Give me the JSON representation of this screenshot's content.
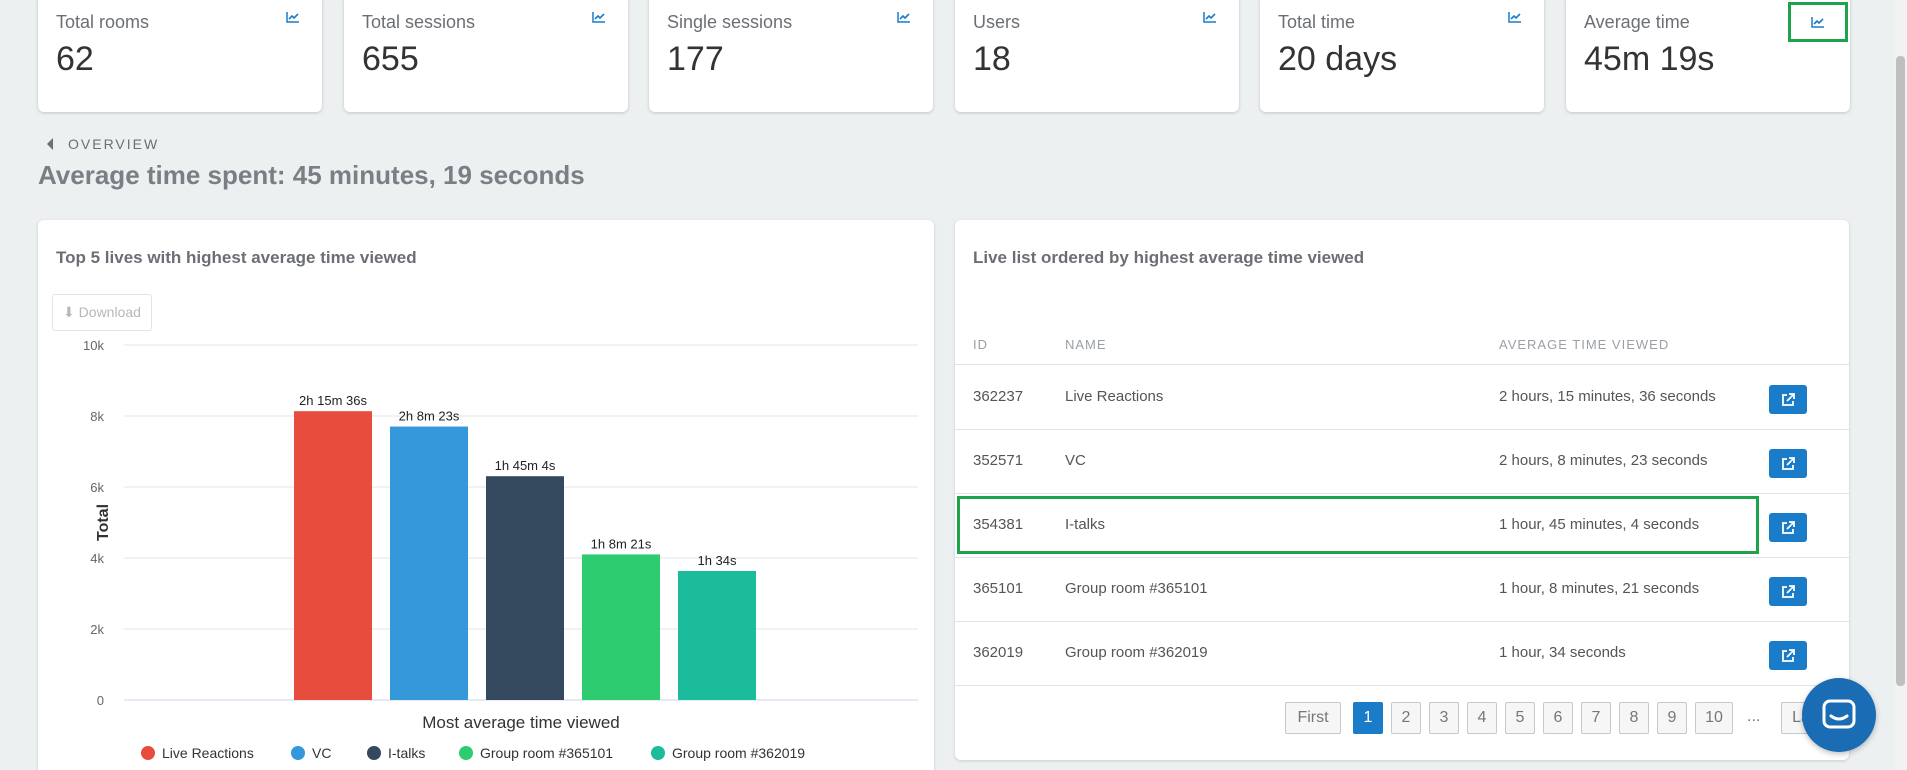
{
  "kpis": [
    {
      "title": "Total rooms",
      "value": "62"
    },
    {
      "title": "Total sessions",
      "value": "655"
    },
    {
      "title": "Single sessions",
      "value": "177"
    },
    {
      "title": "Users",
      "value": "18"
    },
    {
      "title": "Total time",
      "value": "20 days"
    },
    {
      "title": "Average time",
      "value": "45m 19s"
    }
  ],
  "overview": {
    "crumb": "OVERVIEW",
    "title": "Average time spent: 45 minutes, 19 seconds"
  },
  "left_panel": {
    "title": "Top 5 lives with highest average time viewed",
    "download_label": "⬇ Download"
  },
  "chart_data": {
    "type": "bar",
    "categories": [
      "Live Reactions",
      "VC",
      "I-talks",
      "Group room #365101",
      "Group room #362019"
    ],
    "values": [
      8136,
      7703,
      6304,
      4101,
      3634
    ],
    "data_labels": [
      "2h 15m 36s",
      "2h 8m 23s",
      "1h 45m 4s",
      "1h 8m 21s",
      "1h 34s"
    ],
    "colors": [
      "#e74c3c",
      "#3498db",
      "#34495e",
      "#2ecc71",
      "#1abc9c"
    ],
    "xlabel": "Most average time viewed",
    "ylabel": "Total",
    "ylim": [
      0,
      10000
    ],
    "yticks": [
      0,
      2000,
      4000,
      6000,
      8000,
      10000
    ],
    "ytick_labels": [
      "0",
      "2k",
      "4k",
      "6k",
      "8k",
      "10k"
    ],
    "grid": true,
    "legend_position": "bottom"
  },
  "right_panel": {
    "title": "Live list ordered by highest average time viewed",
    "columns": {
      "id": "ID",
      "name": "NAME",
      "avg": "AVERAGE TIME VIEWED"
    },
    "rows": [
      {
        "id": "362237",
        "name": "Live Reactions",
        "avg": "2 hours, 15 minutes, 36 seconds"
      },
      {
        "id": "352571",
        "name": "VC",
        "avg": "2 hours, 8 minutes, 23 seconds"
      },
      {
        "id": "354381",
        "name": "I-talks",
        "avg": "1 hour, 45 minutes, 4 seconds"
      },
      {
        "id": "365101",
        "name": "Group room #365101",
        "avg": "1 hour, 8 minutes, 21 seconds"
      },
      {
        "id": "362019",
        "name": "Group room #362019",
        "avg": "1 hour, 34 seconds"
      }
    ],
    "pagination": {
      "first": "First",
      "pages": [
        "1",
        "2",
        "3",
        "4",
        "5",
        "6",
        "7",
        "8",
        "9",
        "10"
      ],
      "active": "1",
      "ellipsis": "...",
      "last": "La"
    }
  },
  "icons": {
    "kpi_chart": "line-chart-icon",
    "open": "external-link-icon",
    "chat": "chat-icon",
    "back": "caret-left-icon"
  },
  "colors": {
    "accent": "#1a7bc8",
    "highlight": "#1ea34a",
    "background": "#ecf0f1"
  }
}
